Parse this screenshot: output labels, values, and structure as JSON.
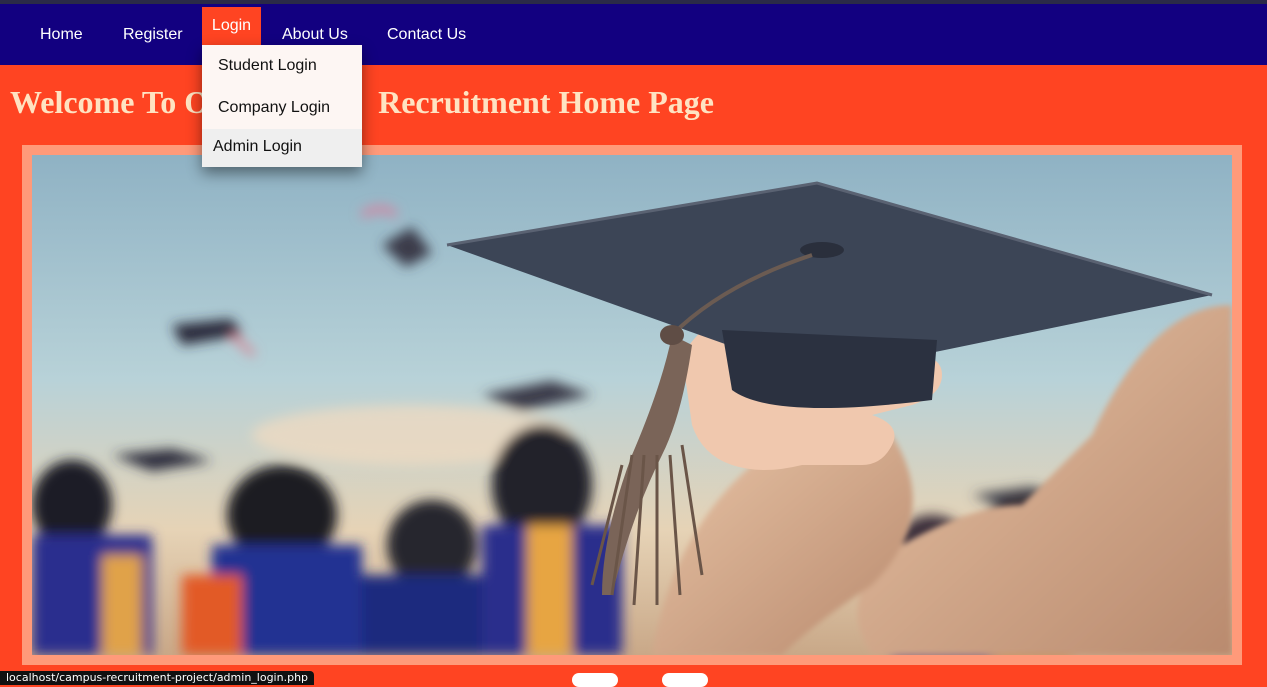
{
  "nav": {
    "home": "Home",
    "register": "Register",
    "login": "Login",
    "about": "About Us",
    "contact": "Contact Us"
  },
  "login_menu": {
    "student": "Student Login",
    "company": "Company Login",
    "admin": "Admin Login"
  },
  "page": {
    "heading_left": "Welcome To O",
    "heading_right": "Recruitment Home Page"
  },
  "hero": {
    "image": "graduation-cap-photo"
  },
  "status": {
    "url": "localhost/campus-recruitment-project/admin_login.php"
  },
  "colors": {
    "navbar": "#120080",
    "accent": "#ff4422",
    "heading": "#ffe3c2",
    "frame": "#ff9a7a"
  }
}
